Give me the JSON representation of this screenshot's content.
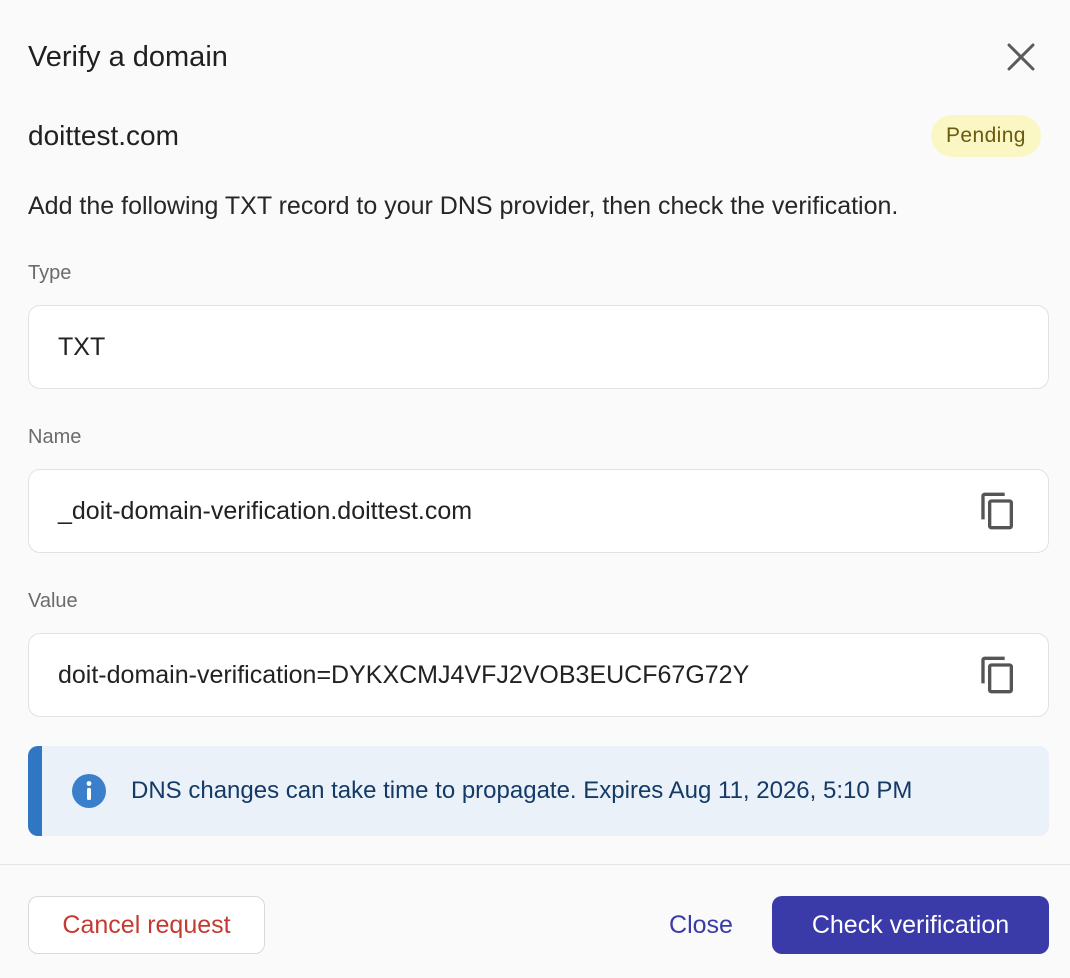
{
  "dialog": {
    "title": "Verify a domain",
    "domain": "doittest.com",
    "status_badge": "Pending",
    "instructions": "Add the following TXT record to your DNS provider, then check the verification."
  },
  "fields": {
    "type": {
      "label": "Type",
      "value": "TXT"
    },
    "name": {
      "label": "Name",
      "value": "_doit-domain-verification.doittest.com",
      "copy_icon": "copy-icon"
    },
    "value": {
      "label": "Value",
      "value": "doit-domain-verification=DYKXCMJ4VFJ2VOB3EUCF67G72Y",
      "copy_icon": "copy-icon"
    }
  },
  "info": {
    "icon": "info-icon",
    "text": "DNS changes can take time to propagate. Expires Aug 11, 2026, 5:10 PM"
  },
  "footer": {
    "cancel_label": "Cancel request",
    "close_label": "Close",
    "check_label": "Check verification"
  },
  "colors": {
    "primary": "#3a3aa8",
    "danger": "#c53a30",
    "pending_bg": "#fbf7c4",
    "pending_text": "#6a5a0e",
    "info_accent": "#2f76c3",
    "info_icon": "#3a7fcb"
  }
}
